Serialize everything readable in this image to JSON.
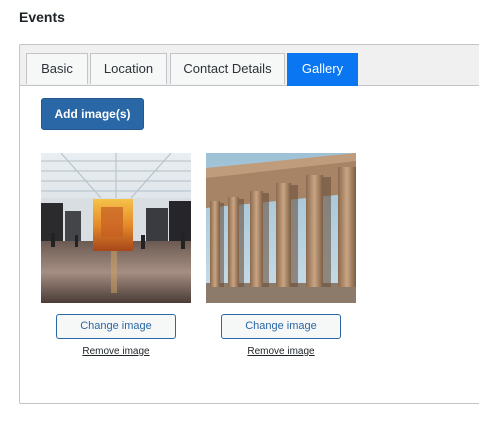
{
  "page": {
    "title": "Events"
  },
  "tabs": [
    {
      "label": "Basic",
      "active": false
    },
    {
      "label": "Location",
      "active": false
    },
    {
      "label": "Contact Details",
      "active": false
    },
    {
      "label": "Gallery",
      "active": true
    }
  ],
  "gallery": {
    "add_label": "Add image(s)",
    "items": [
      {
        "image": "museum-exhibition-hall-photo",
        "change_label": "Change image",
        "remove_label": "Remove image"
      },
      {
        "image": "parthenon-ruins-photo",
        "change_label": "Change image",
        "remove_label": "Remove image"
      }
    ]
  },
  "colors": {
    "active_tab": "#0a76f2",
    "primary_button": "#2a67a6"
  }
}
